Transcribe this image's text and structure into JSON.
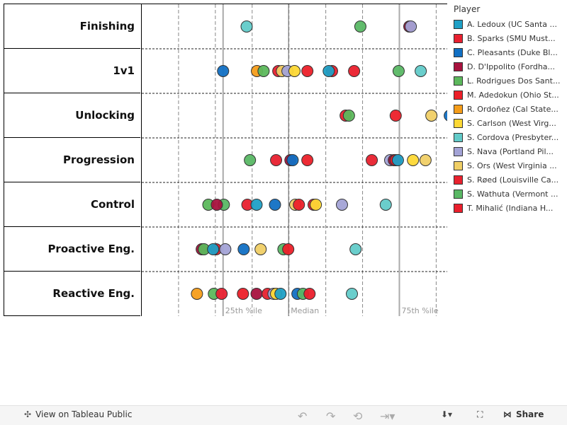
{
  "chart_data": {
    "type": "scatter",
    "categories": [
      "Finishing",
      "1v1",
      "Unlocking",
      "Progression",
      "Control",
      "Proactive Eng.",
      "Reactive Eng."
    ],
    "xlim": [
      0,
      8.3
    ],
    "grid": {
      "vertical_dashed": true,
      "values": [
        1,
        2,
        3,
        4,
        5,
        6,
        7,
        8
      ]
    },
    "reference_lines": [
      {
        "label": "25th %ile",
        "value": 2.21
      },
      {
        "label": "Median",
        "value": 3.99
      },
      {
        "label": "75th %ile",
        "value": 7.0
      }
    ],
    "legend": {
      "title": "Player",
      "placement": "right"
    },
    "players": [
      {
        "name": "A. Ledoux (UC Santa ...",
        "color": "#1fa0c6"
      },
      {
        "name": "B. Sparks (SMU Must...",
        "color": "#e8202f"
      },
      {
        "name": "C. Pleasants (Duke Bl...",
        "color": "#1170c4"
      },
      {
        "name": "D. D'Ippolito (Fordha...",
        "color": "#a8123e"
      },
      {
        "name": "L. Rodrigues Dos Sant...",
        "color": "#5cb85c"
      },
      {
        "name": "M. Adedokun (Ohio St...",
        "color": "#ec2029"
      },
      {
        "name": "R. Ordoñez (Cal State...",
        "color": "#f59d1a"
      },
      {
        "name": "S. Carlson (West Virg...",
        "color": "#fdd835"
      },
      {
        "name": "S. Cordova (Presbyter...",
        "color": "#62cbc9"
      },
      {
        "name": "S. Nava (Portland Pil...",
        "color": "#a3a3d6"
      },
      {
        "name": "S. Ors (West Virginia ...",
        "color": "#f0cf66"
      },
      {
        "name": "S. Røed (Louisville Ca...",
        "color": "#e8212e"
      },
      {
        "name": "S. Wathuta (Vermont ...",
        "color": "#5ab865"
      },
      {
        "name": "T. Mihalić (Indiana H...",
        "color": "#ea1f2c"
      }
    ],
    "points": [
      {
        "c": 0,
        "p": 8,
        "v": 2.85
      },
      {
        "c": 0,
        "p": 12,
        "v": 5.94
      },
      {
        "c": 0,
        "p": 3,
        "v": 7.27
      },
      {
        "c": 0,
        "p": 9,
        "v": 7.31
      },
      {
        "c": 1,
        "p": 2,
        "v": 2.21
      },
      {
        "c": 1,
        "p": 6,
        "v": 3.13
      },
      {
        "c": 1,
        "p": 4,
        "v": 3.31
      },
      {
        "c": 1,
        "p": 1,
        "v": 3.71
      },
      {
        "c": 1,
        "p": 10,
        "v": 3.81
      },
      {
        "c": 1,
        "p": 9,
        "v": 3.96
      },
      {
        "c": 1,
        "p": 7,
        "v": 4.15
      },
      {
        "c": 1,
        "p": 5,
        "v": 4.5
      },
      {
        "c": 1,
        "p": 11,
        "v": 5.17
      },
      {
        "c": 1,
        "p": 0,
        "v": 5.08
      },
      {
        "c": 1,
        "p": 13,
        "v": 5.77
      },
      {
        "c": 1,
        "p": 12,
        "v": 6.98
      },
      {
        "c": 1,
        "p": 8,
        "v": 7.58
      },
      {
        "c": 2,
        "p": 1,
        "v": 5.54
      },
      {
        "c": 2,
        "p": 4,
        "v": 5.63
      },
      {
        "c": 2,
        "p": 5,
        "v": 6.9
      },
      {
        "c": 2,
        "p": 10,
        "v": 7.87
      },
      {
        "c": 2,
        "p": 2,
        "v": 8.37
      },
      {
        "c": 3,
        "p": 12,
        "v": 2.94
      },
      {
        "c": 3,
        "p": 1,
        "v": 3.65
      },
      {
        "c": 3,
        "p": 3,
        "v": 4.04
      },
      {
        "c": 3,
        "p": 2,
        "v": 4.1
      },
      {
        "c": 3,
        "p": 5,
        "v": 4.5
      },
      {
        "c": 3,
        "p": 11,
        "v": 6.25
      },
      {
        "c": 3,
        "p": 9,
        "v": 6.75
      },
      {
        "c": 3,
        "p": 3,
        "v": 6.85
      },
      {
        "c": 3,
        "p": 13,
        "v": 6.9
      },
      {
        "c": 3,
        "p": 0,
        "v": 6.96
      },
      {
        "c": 3,
        "p": 7,
        "v": 7.37
      },
      {
        "c": 3,
        "p": 10,
        "v": 7.71
      },
      {
        "c": 4,
        "p": 4,
        "v": 1.81
      },
      {
        "c": 4,
        "p": 12,
        "v": 2.23
      },
      {
        "c": 4,
        "p": 3,
        "v": 2.04
      },
      {
        "c": 4,
        "p": 1,
        "v": 2.87
      },
      {
        "c": 4,
        "p": 0,
        "v": 3.12
      },
      {
        "c": 4,
        "p": 2,
        "v": 3.62
      },
      {
        "c": 4,
        "p": 10,
        "v": 4.17
      },
      {
        "c": 4,
        "p": 5,
        "v": 4.27
      },
      {
        "c": 4,
        "p": 13,
        "v": 4.67
      },
      {
        "c": 4,
        "p": 7,
        "v": 4.73
      },
      {
        "c": 4,
        "p": 9,
        "v": 5.44
      },
      {
        "c": 4,
        "p": 8,
        "v": 6.63
      },
      {
        "c": 5,
        "p": 3,
        "v": 1.63
      },
      {
        "c": 5,
        "p": 4,
        "v": 1.69
      },
      {
        "c": 5,
        "p": 11,
        "v": 2.02
      },
      {
        "c": 5,
        "p": 0,
        "v": 1.94
      },
      {
        "c": 5,
        "p": 9,
        "v": 2.27
      },
      {
        "c": 5,
        "p": 2,
        "v": 2.77
      },
      {
        "c": 5,
        "p": 10,
        "v": 3.23
      },
      {
        "c": 5,
        "p": 12,
        "v": 3.85
      },
      {
        "c": 5,
        "p": 5,
        "v": 3.98
      },
      {
        "c": 5,
        "p": 8,
        "v": 5.81
      },
      {
        "c": 6,
        "p": 6,
        "v": 1.5
      },
      {
        "c": 6,
        "p": 4,
        "v": 1.96
      },
      {
        "c": 6,
        "p": 1,
        "v": 2.17
      },
      {
        "c": 6,
        "p": 5,
        "v": 2.75
      },
      {
        "c": 6,
        "p": 3,
        "v": 3.12
      },
      {
        "c": 6,
        "p": 11,
        "v": 3.42
      },
      {
        "c": 6,
        "p": 9,
        "v": 3.58
      },
      {
        "c": 6,
        "p": 7,
        "v": 3.65
      },
      {
        "c": 6,
        "p": 0,
        "v": 3.77
      },
      {
        "c": 6,
        "p": 2,
        "v": 4.23
      },
      {
        "c": 6,
        "p": 12,
        "v": 4.38
      },
      {
        "c": 6,
        "p": 13,
        "v": 4.56
      },
      {
        "c": 6,
        "p": 8,
        "v": 5.71
      }
    ]
  },
  "footer": {
    "view_label": "View on Tableau Public",
    "share_label": "Share",
    "icons": [
      "tableau-icon",
      "undo-icon",
      "redo-icon",
      "revert-icon",
      "refresh-icon",
      "download-icon",
      "fullscreen-icon",
      "share-icon"
    ]
  }
}
